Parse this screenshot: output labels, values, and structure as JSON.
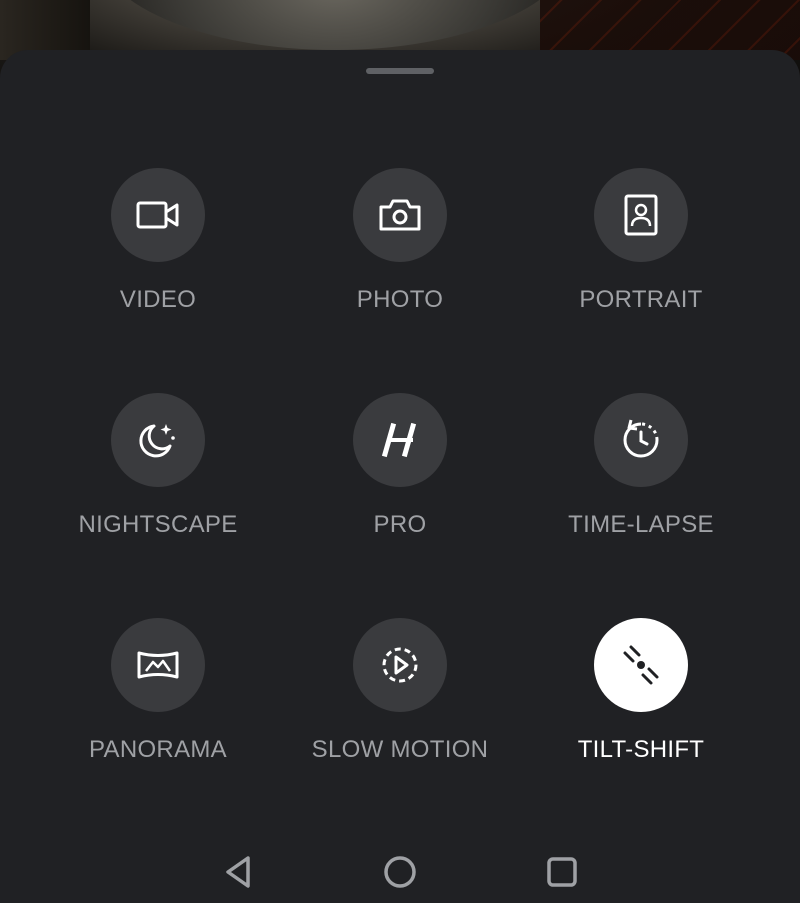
{
  "modes": [
    {
      "label": "VIDEO",
      "icon": "video-camera-icon",
      "active": false
    },
    {
      "label": "PHOTO",
      "icon": "photo-camera-icon",
      "active": false
    },
    {
      "label": "PORTRAIT",
      "icon": "portrait-icon",
      "active": false
    },
    {
      "label": "NIGHTSCAPE",
      "icon": "moon-stars-icon",
      "active": false
    },
    {
      "label": "PRO",
      "icon": "hasselblad-h-icon",
      "active": false
    },
    {
      "label": "TIME-LAPSE",
      "icon": "timer-rotate-icon",
      "active": false
    },
    {
      "label": "PANORAMA",
      "icon": "panorama-icon",
      "active": false
    },
    {
      "label": "SLOW MOTION",
      "icon": "slow-motion-play-icon",
      "active": false
    },
    {
      "label": "TILT-SHIFT",
      "icon": "tilt-shift-icon",
      "active": true
    }
  ],
  "navbar": {
    "back": "back-triangle-icon",
    "home": "home-circle-icon",
    "recents": "recents-square-icon"
  },
  "colors": {
    "sheet_bg": "#202124",
    "icon_circle": "#3a3b3e",
    "label_inactive": "#9fa1a5",
    "active": "#ffffff"
  }
}
